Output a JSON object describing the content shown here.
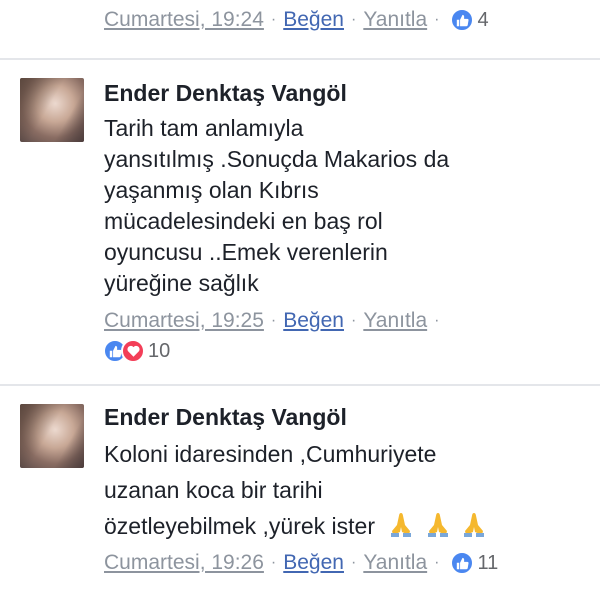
{
  "comment_top": {
    "time": "Cumartesi, 19:24",
    "like": "Beğen",
    "reply": "Yanıtla",
    "reaction_count": "4"
  },
  "comments": [
    {
      "author": "Ender Denktaş Vangöl",
      "lines": [
        "Tarih tam anlamıyla",
        "yansıtılmış .Sonuçda Makarios da",
        "yaşanmış olan Kıbrıs",
        "mücadelesindeki en baş rol",
        "oyuncusu ..Emek verenlerin",
        "yüreğine sağlık"
      ],
      "time": "Cumartesi, 19:25",
      "like": "Beğen",
      "reply": "Yanıtla",
      "reaction_count": "10"
    },
    {
      "author": "Ender Denktaş Vangöl",
      "lines": [
        "Koloni idaresinden ,Cumhuriyete",
        "uzanan koca bir tarihi",
        "özetleyebilmek ,yürek ister"
      ],
      "emoji": "folded-hands-icon x3",
      "time": "Cumartesi, 19:26",
      "like": "Beğen",
      "reply": "Yanıtla",
      "reaction_count": "11"
    }
  ],
  "colors": {
    "link_blue": "#4267b2",
    "meta_gray": "#8d949e",
    "like_badge": "#4a87f0",
    "heart_badge": "#f33e58"
  }
}
